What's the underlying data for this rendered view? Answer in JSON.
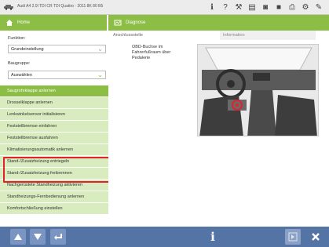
{
  "topbar": {
    "vehicle": "Audi A4 2.0l TDI CR TDI Quattro · 2011 8K 80 B5",
    "icons": [
      "car-icon",
      "info-icon",
      "question-icon",
      "wrench-icon",
      "document-icon",
      "camera-icon",
      "disk-icon",
      "printer-icon",
      "settings-icon",
      "tools-icon"
    ]
  },
  "header": {
    "home_label": "Home",
    "diag_label": "Diagnose"
  },
  "left": {
    "function_label": "Funktion:",
    "function_value": "Grundeinstellung",
    "group_label": "Baugruppe:",
    "group_value": "Auswählen",
    "items": [
      "Saugrohrklappe anlernen",
      "Drosselklappe anlernen",
      "Lenkwinkelsensor initialisieren",
      "Feststellbremse einfahren",
      "Feststellbremse ausfahren",
      "Klimatisierungsautomatik anlernen",
      "Stand-/Zusatzheizung entriegeln",
      "Stand-/Zusatzheizung freibrennen",
      "Nachgerüstete Standheizung aktivieren",
      "Standheizungs-Fernbedienung anlernen",
      "Komfortschließung einstellen"
    ]
  },
  "right": {
    "col_header": "Anschlussstelle",
    "info_header": "Information",
    "location_text": "OBD-Buchse im Fahrerfußraum über Pedalerie"
  },
  "bottombar": {
    "icons": [
      "arrow-up-icon",
      "arrow-down-icon",
      "enter-icon",
      "info-icon",
      "next-icon",
      "close-icon"
    ]
  },
  "colors": {
    "accent_green": "#8cbd45",
    "list_bg": "#d9ecbf",
    "bottom_blue": "#5574a6",
    "highlight_red": "#e0222b"
  }
}
